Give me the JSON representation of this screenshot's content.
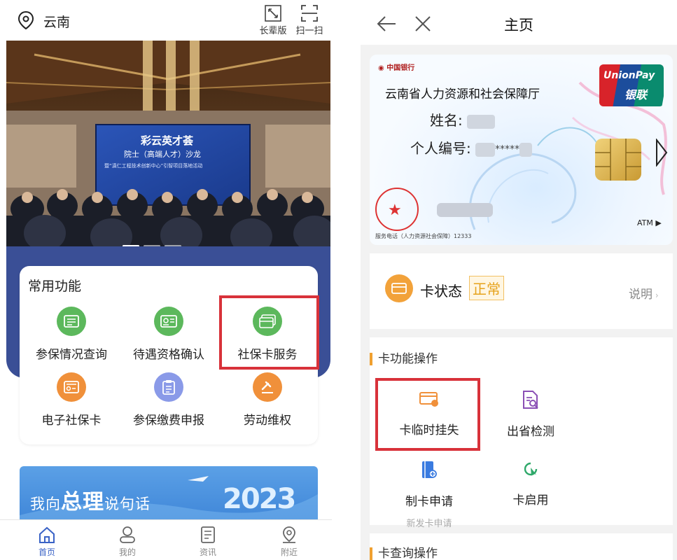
{
  "left": {
    "location": "云南",
    "top_buttons": [
      {
        "label": "长辈版",
        "icon": "expand-icon"
      },
      {
        "label": "扫一扫",
        "icon": "scan-icon"
      }
    ],
    "banner": {
      "screen_title": "彩云英才荟",
      "screen_subtitle": "院士（高端人才）沙龙",
      "screen_line": "暨“滇仁工程技术创新中心”引智项目落地活动"
    },
    "common_functions": {
      "title": "常用功能",
      "items": [
        {
          "label": "参保情况查询",
          "icon": "insurance-query-icon",
          "color": "#5cb85c"
        },
        {
          "label": "待遇资格确认",
          "icon": "benefit-confirm-icon",
          "color": "#5cb85c"
        },
        {
          "label": "社保卡服务",
          "icon": "card-service-icon",
          "color": "#5cb85c"
        },
        {
          "label": "电子社保卡",
          "icon": "e-card-icon",
          "color": "#f0903a"
        },
        {
          "label": "参保缴费申报",
          "icon": "payment-declare-icon",
          "color": "#8a9ae8"
        },
        {
          "label": "劳动维权",
          "icon": "labor-rights-icon",
          "color": "#f0903a"
        }
      ]
    },
    "promo": {
      "text_pre": "我向",
      "text_big": "总理",
      "text_post": "说句话",
      "year": "2023"
    },
    "tabs": [
      {
        "label": "首页",
        "icon": "home-icon",
        "active": true
      },
      {
        "label": "我的",
        "icon": "profile-icon",
        "active": false
      },
      {
        "label": "资讯",
        "icon": "news-icon",
        "active": false
      },
      {
        "label": "附近",
        "icon": "nearby-icon",
        "active": false
      }
    ],
    "accent": "#3a63c6",
    "highlight_color": "#d8323a"
  },
  "right": {
    "title": "主页",
    "card": {
      "bank": "中国银行",
      "org": "云南省人力资源和社会保障厅",
      "name_label": "姓名:",
      "id_label": "个人编号:",
      "id_mask": "*****",
      "unionpay_en": "UnionPay",
      "unionpay_cn": "银联",
      "atm": "ATM ▶",
      "service_phone": "服务电话（人力资源社会保障）12333"
    },
    "status": {
      "label": "卡状态",
      "value": "正常",
      "help": "说明"
    },
    "card_ops": {
      "title": "卡功能操作",
      "items": [
        {
          "label": "卡临时挂失",
          "icon": "card-loss-icon",
          "color": "#f0903a"
        },
        {
          "label": "出省检测",
          "icon": "province-check-icon",
          "color": "#8a4fb5"
        },
        {
          "label": "制卡申请",
          "sub": "新发卡申请",
          "icon": "card-apply-icon",
          "color": "#3a7be0"
        },
        {
          "label": "卡启用",
          "icon": "card-enable-icon",
          "color": "#2fa86a"
        }
      ]
    },
    "card_query": {
      "title": "卡查询操作"
    }
  }
}
